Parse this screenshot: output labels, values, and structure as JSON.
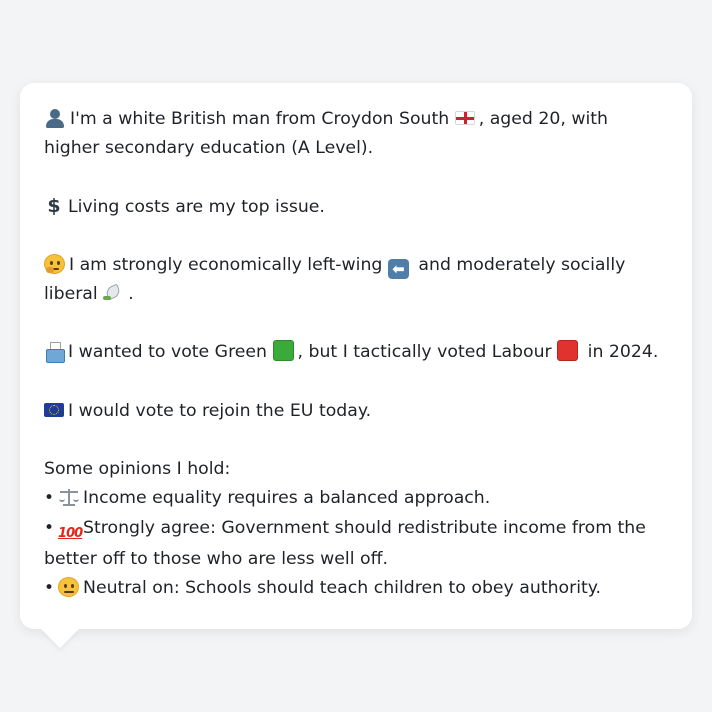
{
  "message": {
    "p1_text1": "I'm a white British man from Croydon South",
    "p1_text2": ", aged 20, with higher secondary education (A Level).",
    "p2_text": "Living costs are my top issue.",
    "p3_text1": "I am strongly economically left-wing",
    "p3_text2": "and moderately socially liberal",
    "p3_text3": ".",
    "p4_text1": "I wanted to vote Green",
    "p4_text2": ", but I tactically voted Labour",
    "p4_text3": "in 2024.",
    "p5_text": "I would vote to rejoin the EU today.",
    "opinions_heading": "Some opinions I hold:",
    "opinions": [
      {
        "icon": "balance-scale-icon",
        "text": "Income equality requires a balanced approach."
      },
      {
        "icon": "hundred-points-icon",
        "text": "Strongly agree: Government should redistribute income from the better off to those who are less well off."
      },
      {
        "icon": "neutral-face-icon",
        "text": "Neutral on: Schools should teach children to obey authority."
      }
    ],
    "bullet": "•",
    "hundred_glyph": "100"
  },
  "colors": {
    "background": "#f3f4f6",
    "bubble": "#ffffff",
    "green_party": "#3aaa3a",
    "labour_party": "#e0322f",
    "text": "#1f2328"
  }
}
